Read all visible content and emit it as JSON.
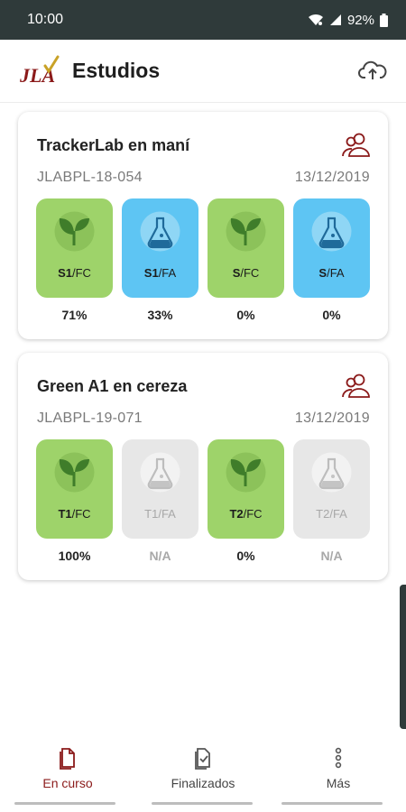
{
  "status_bar": {
    "time": "10:00",
    "battery": "92%"
  },
  "header": {
    "title": "Estudios",
    "logo_text": "JLA"
  },
  "studies": [
    {
      "title": "TrackerLab en maní",
      "code": "JLABPL-18-054",
      "date": "13/12/2019",
      "tiles": [
        {
          "bold": "S1",
          "rest": "/FC",
          "pct": "71%",
          "kind": "plant",
          "color": "green"
        },
        {
          "bold": "S1",
          "rest": "/FA",
          "pct": "33%",
          "kind": "flask",
          "color": "blue"
        },
        {
          "bold": "S",
          "rest": "/FC",
          "pct": "0%",
          "kind": "plant",
          "color": "green"
        },
        {
          "bold": "S",
          "rest": "/FA",
          "pct": "0%",
          "kind": "flask",
          "color": "blue"
        }
      ]
    },
    {
      "title": "Green A1 en cereza",
      "code": "JLABPL-19-071",
      "date": "13/12/2019",
      "tiles": [
        {
          "bold": "T1",
          "rest": "/FC",
          "pct": "100%",
          "kind": "plant",
          "color": "green"
        },
        {
          "bold": "",
          "rest": "T1/FA",
          "pct": "N/A",
          "kind": "flask",
          "color": "gray"
        },
        {
          "bold": "T2",
          "rest": "/FC",
          "pct": "0%",
          "kind": "plant",
          "color": "green"
        },
        {
          "bold": "",
          "rest": "T2/FA",
          "pct": "N/A",
          "kind": "flask",
          "color": "gray"
        }
      ]
    }
  ],
  "nav": {
    "items": [
      {
        "label": "En curso",
        "icon": "document-icon",
        "active": true
      },
      {
        "label": "Finalizados",
        "icon": "document-check-icon",
        "active": false
      },
      {
        "label": "Más",
        "icon": "more-vertical-icon",
        "active": false
      }
    ]
  },
  "colors": {
    "accent": "#8b1a1a",
    "green_tile": "#9ed36a",
    "blue_tile": "#5ec5f3",
    "gray_tile": "#e7e7e7",
    "status_bar": "#2f3a3a"
  }
}
